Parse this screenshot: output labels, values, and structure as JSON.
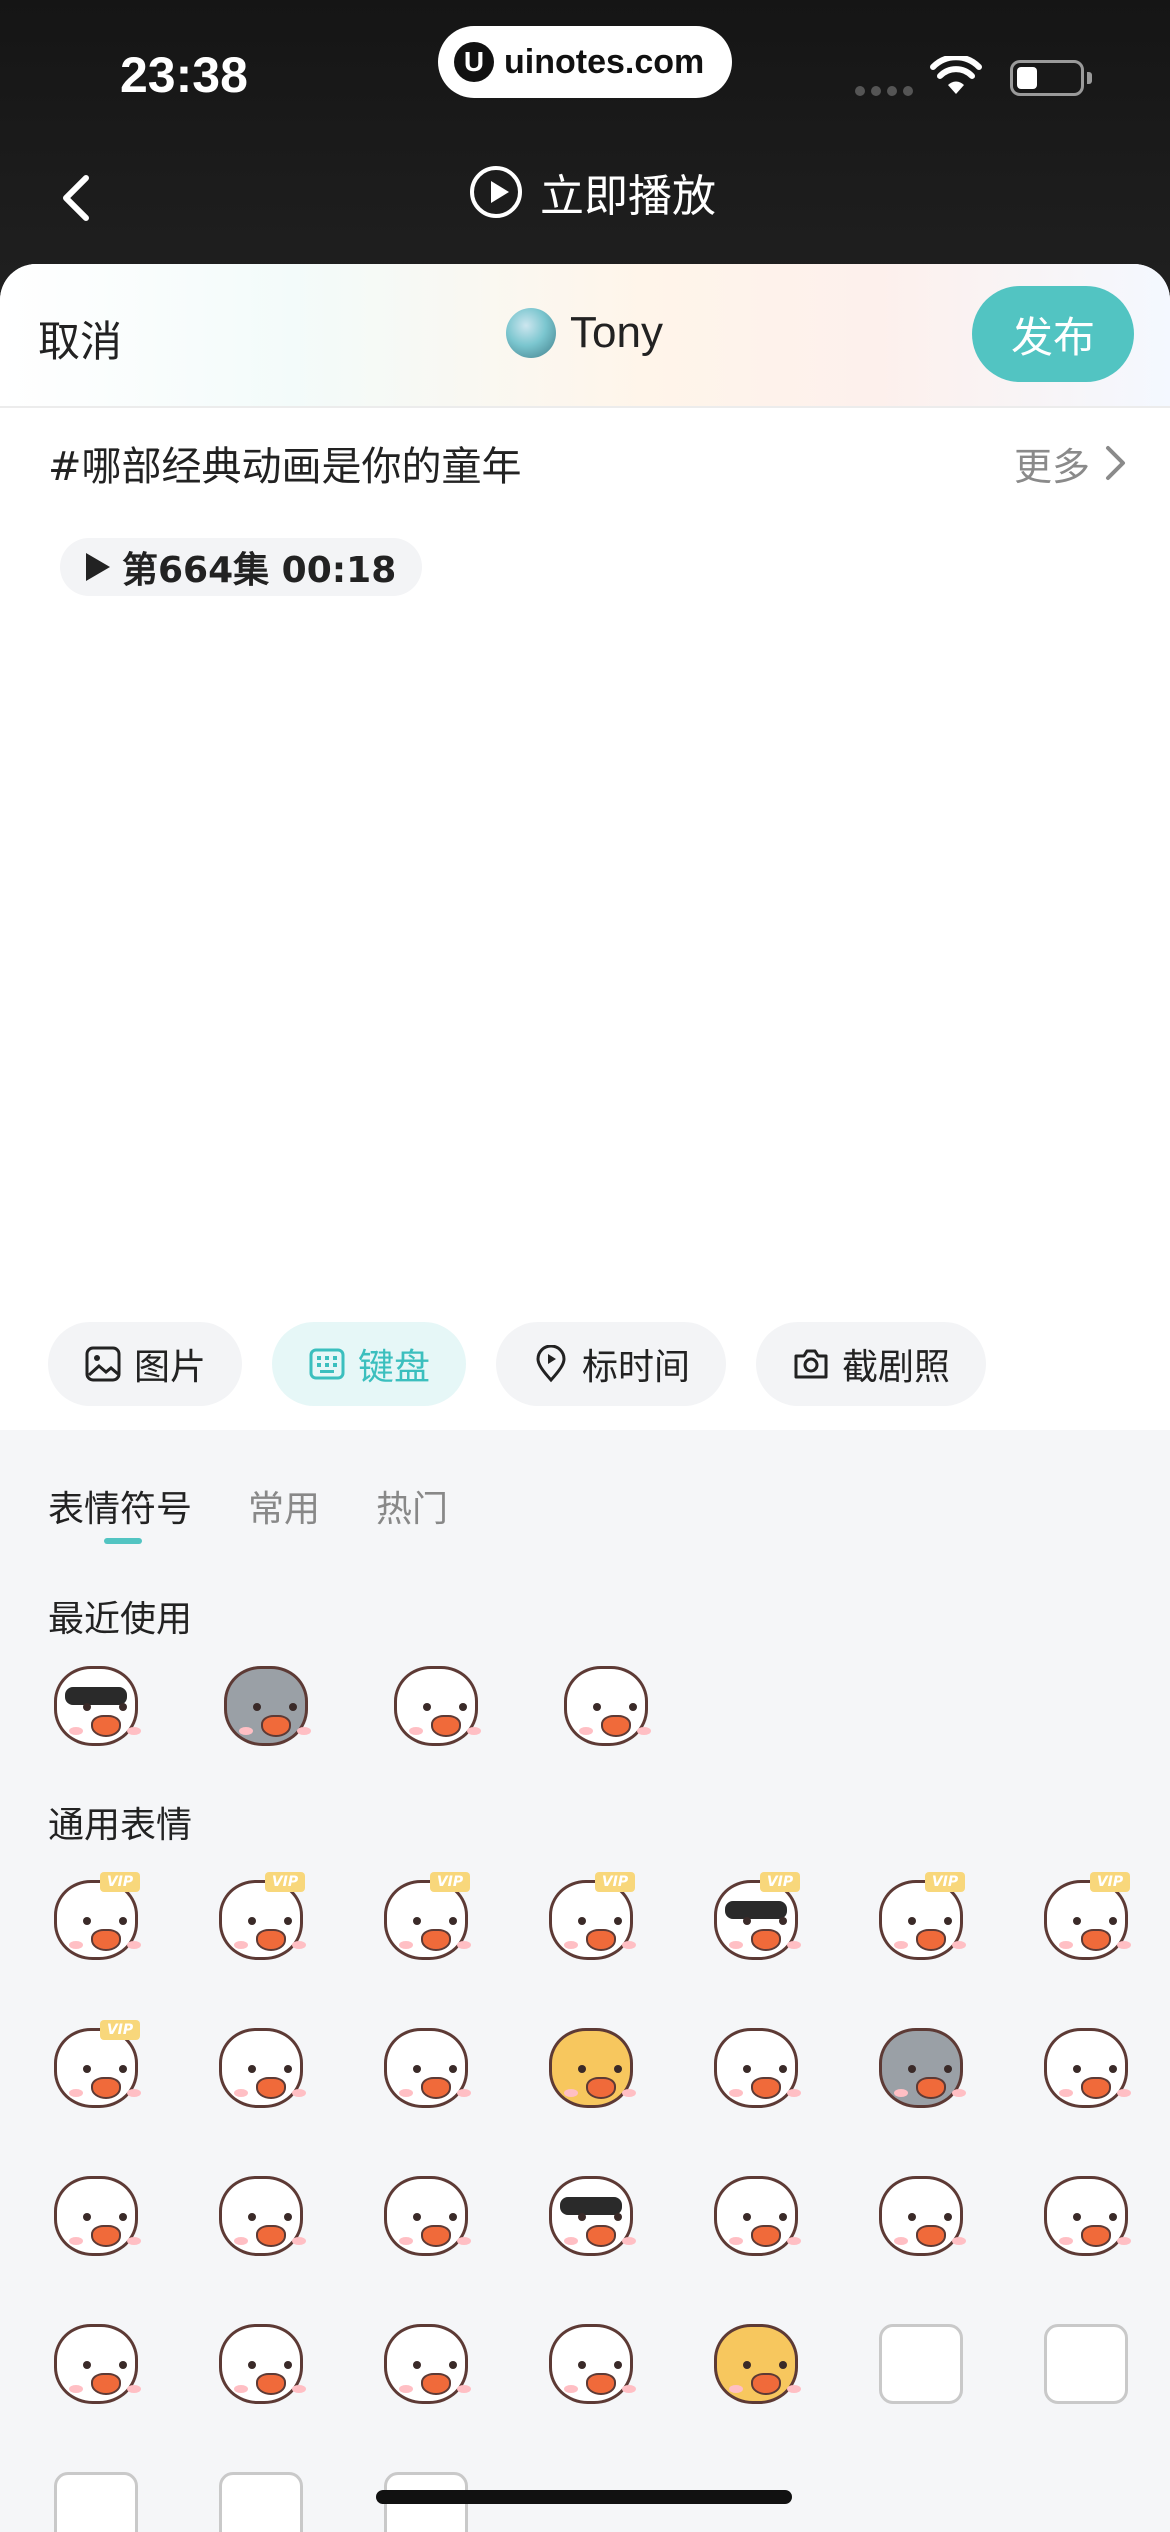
{
  "status_bar": {
    "time": "23:38",
    "url": "uinotes.com",
    "url_logo": "U"
  },
  "nav": {
    "title": "立即播放"
  },
  "sheet": {
    "cancel_label": "取消",
    "user_name": "Tony",
    "publish_label": "发布",
    "topic": "#哪部经典动画是你的童年",
    "more_label": "更多",
    "episode_label": "第664集 00:18"
  },
  "toolbar": {
    "image_label": "图片",
    "keyboard_label": "键盘",
    "timestamp_label": "标时间",
    "screenshot_label": "截剧照"
  },
  "emoji_panel": {
    "tabs": [
      "表情符号",
      "常用",
      "热门"
    ],
    "recent_title": "最近使用",
    "general_title": "通用表情",
    "vip_label": "VIP",
    "accent_color": "#52c4c2"
  }
}
